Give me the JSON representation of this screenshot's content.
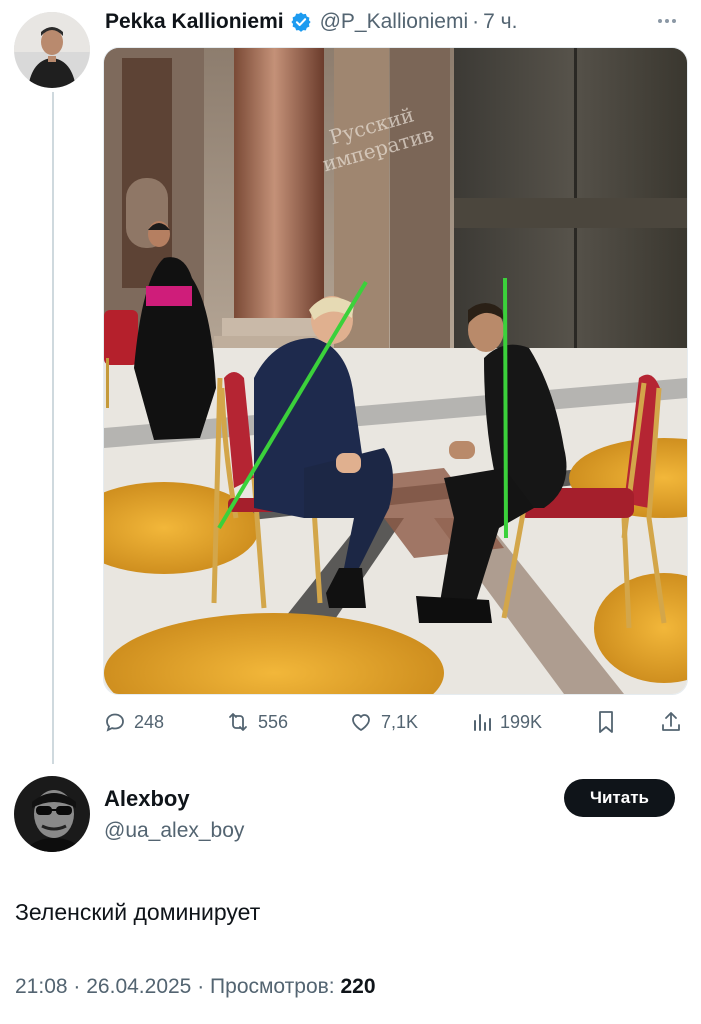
{
  "quoted_tweet": {
    "author_name": "Pekka Kallioniemi",
    "handle": "@P_Kallioniemi",
    "separator": "·",
    "time": "7 ч.",
    "watermark_line1": "Русский",
    "watermark_line2": "императив",
    "stats": {
      "replies": "248",
      "reposts": "556",
      "likes": "7,1K",
      "views": "199K"
    }
  },
  "reply": {
    "author_name": "Alexboy",
    "handle": "@ua_alex_boy",
    "follow_label": "Читать",
    "text": "Зеленский доминирует",
    "time": "21:08",
    "date": "26.04.2025",
    "views_label": "Просмотров:",
    "views_count": "220"
  },
  "colors": {
    "text_primary": "#0f1419",
    "text_secondary": "#536471",
    "verified_blue": "#1d9bf0",
    "thread_line": "#cfd9de",
    "annotation_green": "#3bd13b"
  },
  "icons": [
    "verified-badge-icon",
    "more-icon",
    "reply-icon",
    "repost-icon",
    "like-icon",
    "views-icon",
    "bookmark-icon",
    "share-icon"
  ]
}
